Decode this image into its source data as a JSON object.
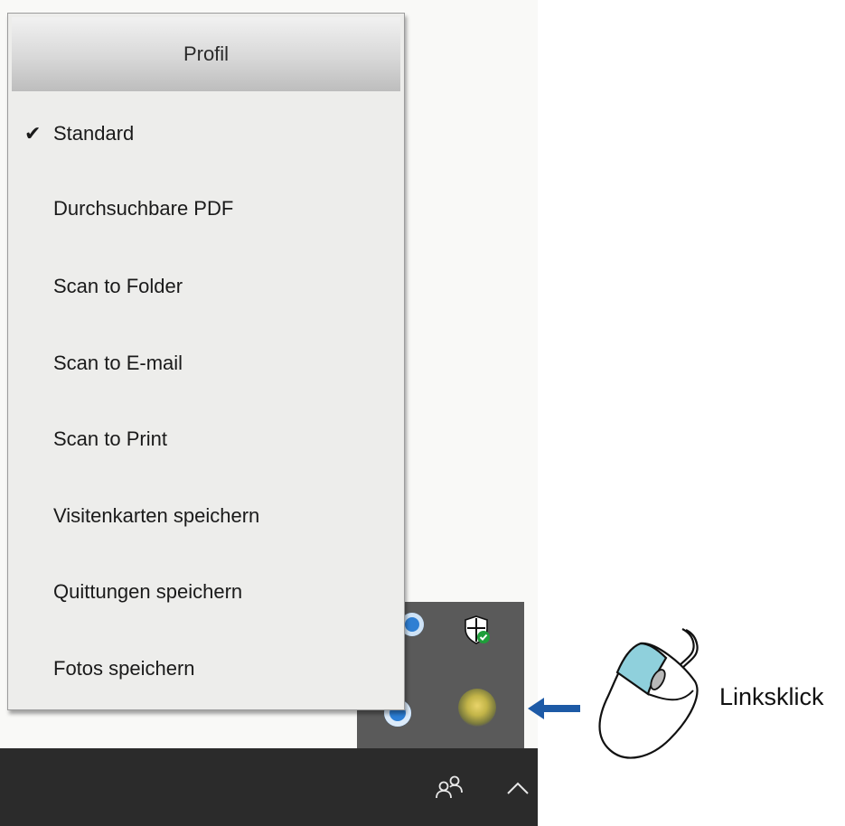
{
  "menu": {
    "header": "Profil",
    "items": [
      {
        "label": "Standard",
        "checked": true
      },
      {
        "label": "Durchsuchbare PDF",
        "checked": false
      },
      {
        "label": "Scan to Folder",
        "checked": false
      },
      {
        "label": "Scan to E-mail",
        "checked": false
      },
      {
        "label": "Scan to Print",
        "checked": false
      },
      {
        "label": "Visitenkarten speichern",
        "checked": false
      },
      {
        "label": "Quittungen speichern",
        "checked": false
      },
      {
        "label": "Fotos speichern",
        "checked": false
      }
    ],
    "check_glyph": "✔"
  },
  "annotation": {
    "caption": "Linksklick",
    "arrow_color": "#1d5aa6",
    "mouse_button_color": "#8fd0dc"
  },
  "tray": {
    "icons": [
      "blue-app-icon",
      "security-shield-icon",
      "blue-circle-app-icon",
      "scanner-app-icon"
    ]
  },
  "taskbar": {
    "icons": [
      "people-icon",
      "chevron-up-icon"
    ]
  }
}
